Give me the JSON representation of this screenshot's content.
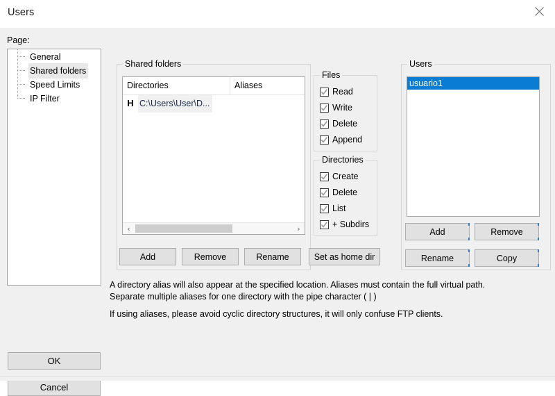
{
  "window": {
    "title": "Users",
    "close_icon": "close-icon"
  },
  "sidebar": {
    "label": "Page:",
    "items": [
      {
        "label": "General",
        "selected": false
      },
      {
        "label": "Shared folders",
        "selected": true
      },
      {
        "label": "Speed Limits",
        "selected": false
      },
      {
        "label": "IP Filter",
        "selected": false
      }
    ]
  },
  "shared_folders": {
    "group_title": "Shared folders",
    "columns": [
      "Directories",
      "Aliases"
    ],
    "rows": [
      {
        "home_flag": "H",
        "directory": "C:\\Users\\User\\D...",
        "alias": ""
      }
    ],
    "scrollbar": {
      "left_arrow": "‹",
      "right_arrow": "›"
    },
    "buttons": {
      "add": "Add",
      "remove": "Remove",
      "rename": "Rename",
      "set_home": "Set as home dir"
    }
  },
  "files_permissions": {
    "group_title": "Files",
    "items": [
      {
        "label": "Read",
        "checked": true
      },
      {
        "label": "Write",
        "checked": true
      },
      {
        "label": "Delete",
        "checked": true
      },
      {
        "label": "Append",
        "checked": true
      }
    ]
  },
  "directories_permissions": {
    "group_title": "Directories",
    "items": [
      {
        "label": "Create",
        "checked": true
      },
      {
        "label": "Delete",
        "checked": true
      },
      {
        "label": "List",
        "checked": true
      },
      {
        "label": "+ Subdirs",
        "checked": true
      }
    ]
  },
  "users": {
    "group_title": "Users",
    "items": [
      {
        "label": "usuario1",
        "selected": true
      }
    ],
    "buttons": {
      "add": "Add",
      "remove": "Remove",
      "rename": "Rename",
      "copy": "Copy"
    }
  },
  "help": {
    "paragraph1": "A directory alias will also appear at the specified location. Aliases must contain the full virtual path. Separate multiple aliases for one directory with the pipe character ( | )",
    "paragraph2": "If using aliases, please avoid cyclic directory structures, it will only confuse FTP clients."
  },
  "dialog_buttons": {
    "ok": "OK",
    "cancel": "Cancel"
  },
  "colors": {
    "selection_blue": "#0a7cd4",
    "window_background": "#f0f0f0",
    "titlebar_background": "#ffffff",
    "button_face": "#e1e1e1",
    "tree_selection": "#e8e8e8"
  }
}
